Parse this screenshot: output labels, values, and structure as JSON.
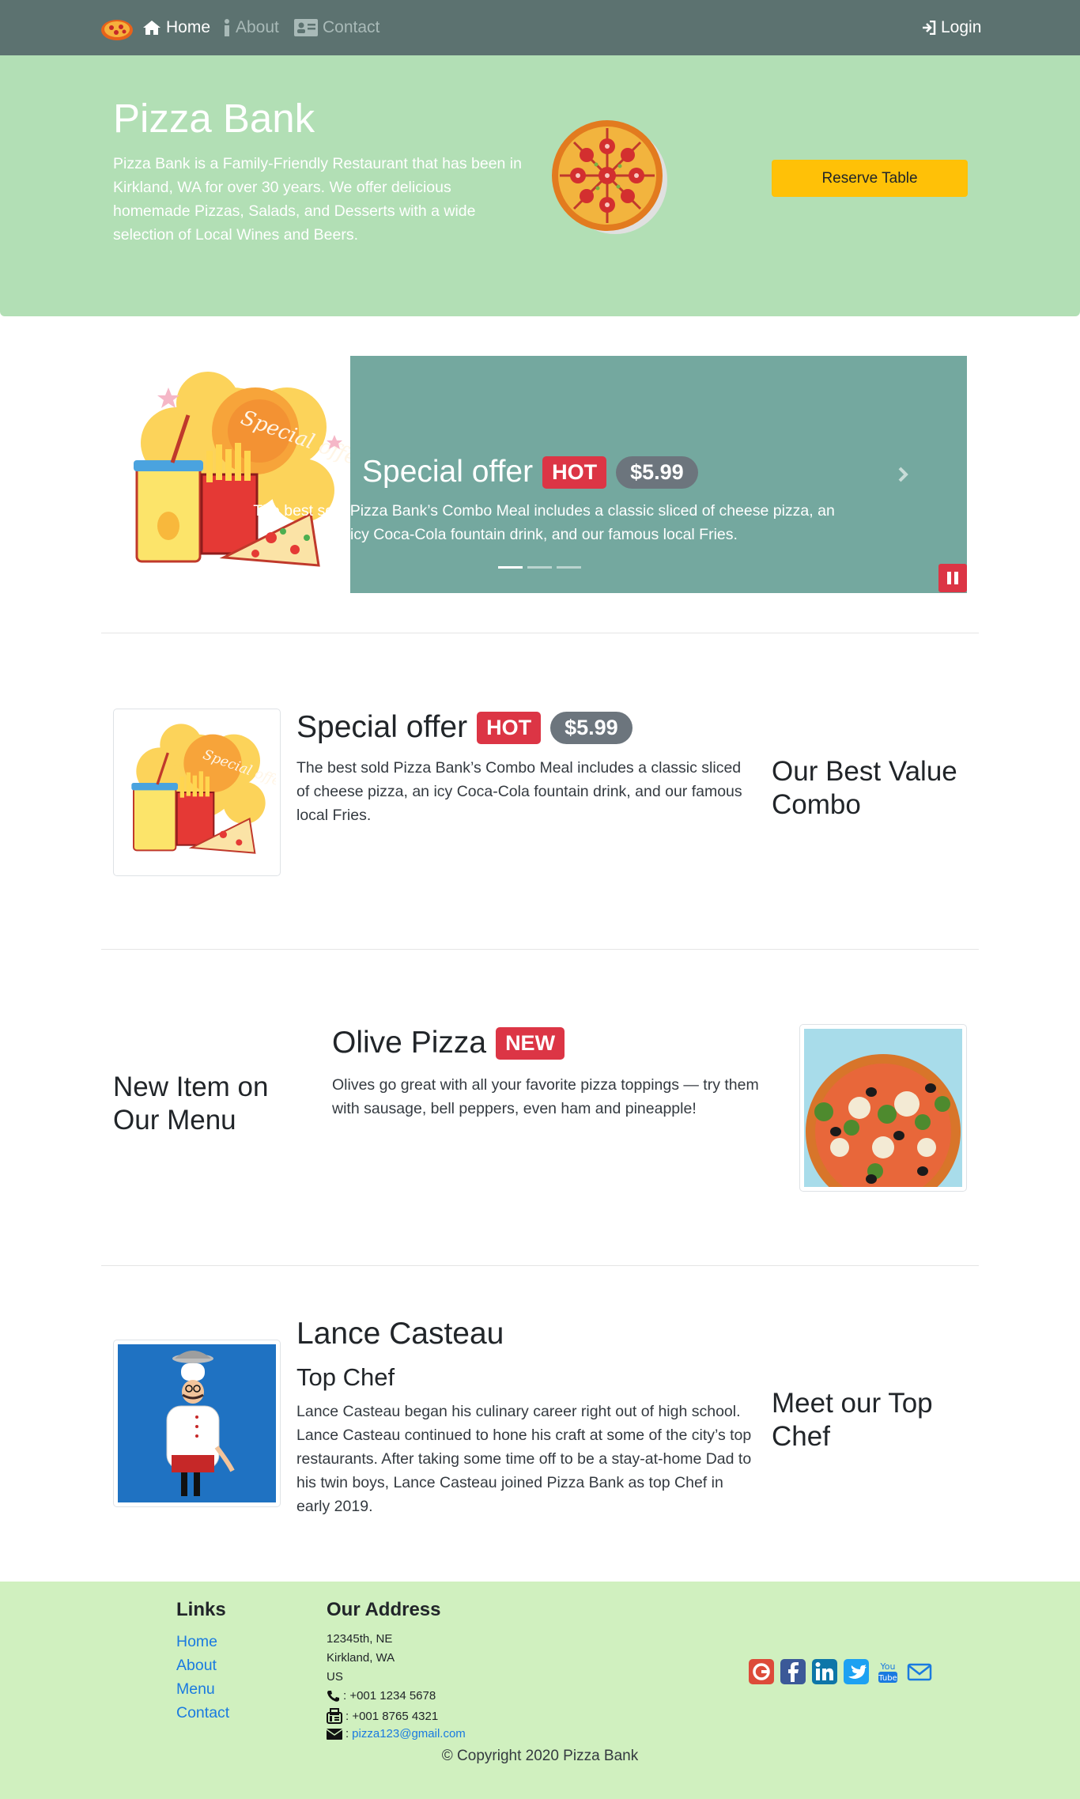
{
  "nav": {
    "home": "Home",
    "about": "About",
    "contact": "Contact",
    "login": "Login"
  },
  "hero": {
    "title": "Pizza Bank",
    "text": "Pizza Bank is a Family-Friendly Restaurant that has been in Kirkland, WA for over 30 years. We offer delicious homemade Pizzas, Salads, and Desserts with a wide selection of Local Wines and Beers.",
    "reserve_label": "Reserve Table"
  },
  "carousel": {
    "title": "Special offer",
    "badge": "HOT",
    "price": "$5.99",
    "caption": "The best sold Pizza Bank’s Combo Meal includes a classic sliced of cheese pizza, an icy Coca-Cola fountain drink, and our famous local Fries.",
    "active_slide": 1,
    "slide_count": 3,
    "image_text": "Special offer"
  },
  "special": {
    "title": "Special offer",
    "badge": "HOT",
    "price": "$5.99",
    "text": "The best sold Pizza Bank’s Combo Meal includes a classic sliced of cheese pizza, an icy Coca-Cola fountain drink, and our famous local Fries.",
    "side_heading": "Our Best Value Combo",
    "image_text": "Special offer"
  },
  "new_item": {
    "side_heading": "New Item on Our Menu",
    "title": "Olive Pizza",
    "badge": "NEW",
    "text": "Olives go great with all your favorite pizza toppings — try them with sausage, bell peppers, even ham and pineapple!"
  },
  "chef": {
    "name": "Lance Casteau",
    "role": "Top Chef",
    "bio": "Lance Casteau began his culinary career right out of high school. Lance Casteau continued to hone his craft at some of the city’s top restaurants. After taking some time off to be a stay-at-home Dad to his twin boys, Lance Casteau joined Pizza Bank as top Chef in early 2019.",
    "side_heading": "Meet our Top Chef"
  },
  "footer": {
    "links_heading": "Links",
    "links": [
      "Home",
      "About",
      "Menu",
      "Contact"
    ],
    "address_heading": "Our Address",
    "address": [
      "12345th, NE",
      "Kirkland, WA",
      "US"
    ],
    "phone": ": +001 1234 5678",
    "fax": ": +001 8765 4321",
    "email_prefix": ":",
    "email": "pizza123@gmail.com",
    "copyright": "© Copyright 2020 Pizza Bank",
    "social_icons": [
      "google-plus-icon",
      "facebook-icon",
      "linkedin-icon",
      "twitter-icon",
      "youtube-icon",
      "envelope-icon"
    ]
  },
  "colors": {
    "navbar": "#5c7270",
    "hero": "#b2dfb5",
    "carousel": "#74a89f",
    "reserve_button": "#ffc107",
    "badge_red": "#dc3545",
    "badge_gray": "#6c757d",
    "footer": "#d0f0bf",
    "link": "#1a7ae0"
  }
}
